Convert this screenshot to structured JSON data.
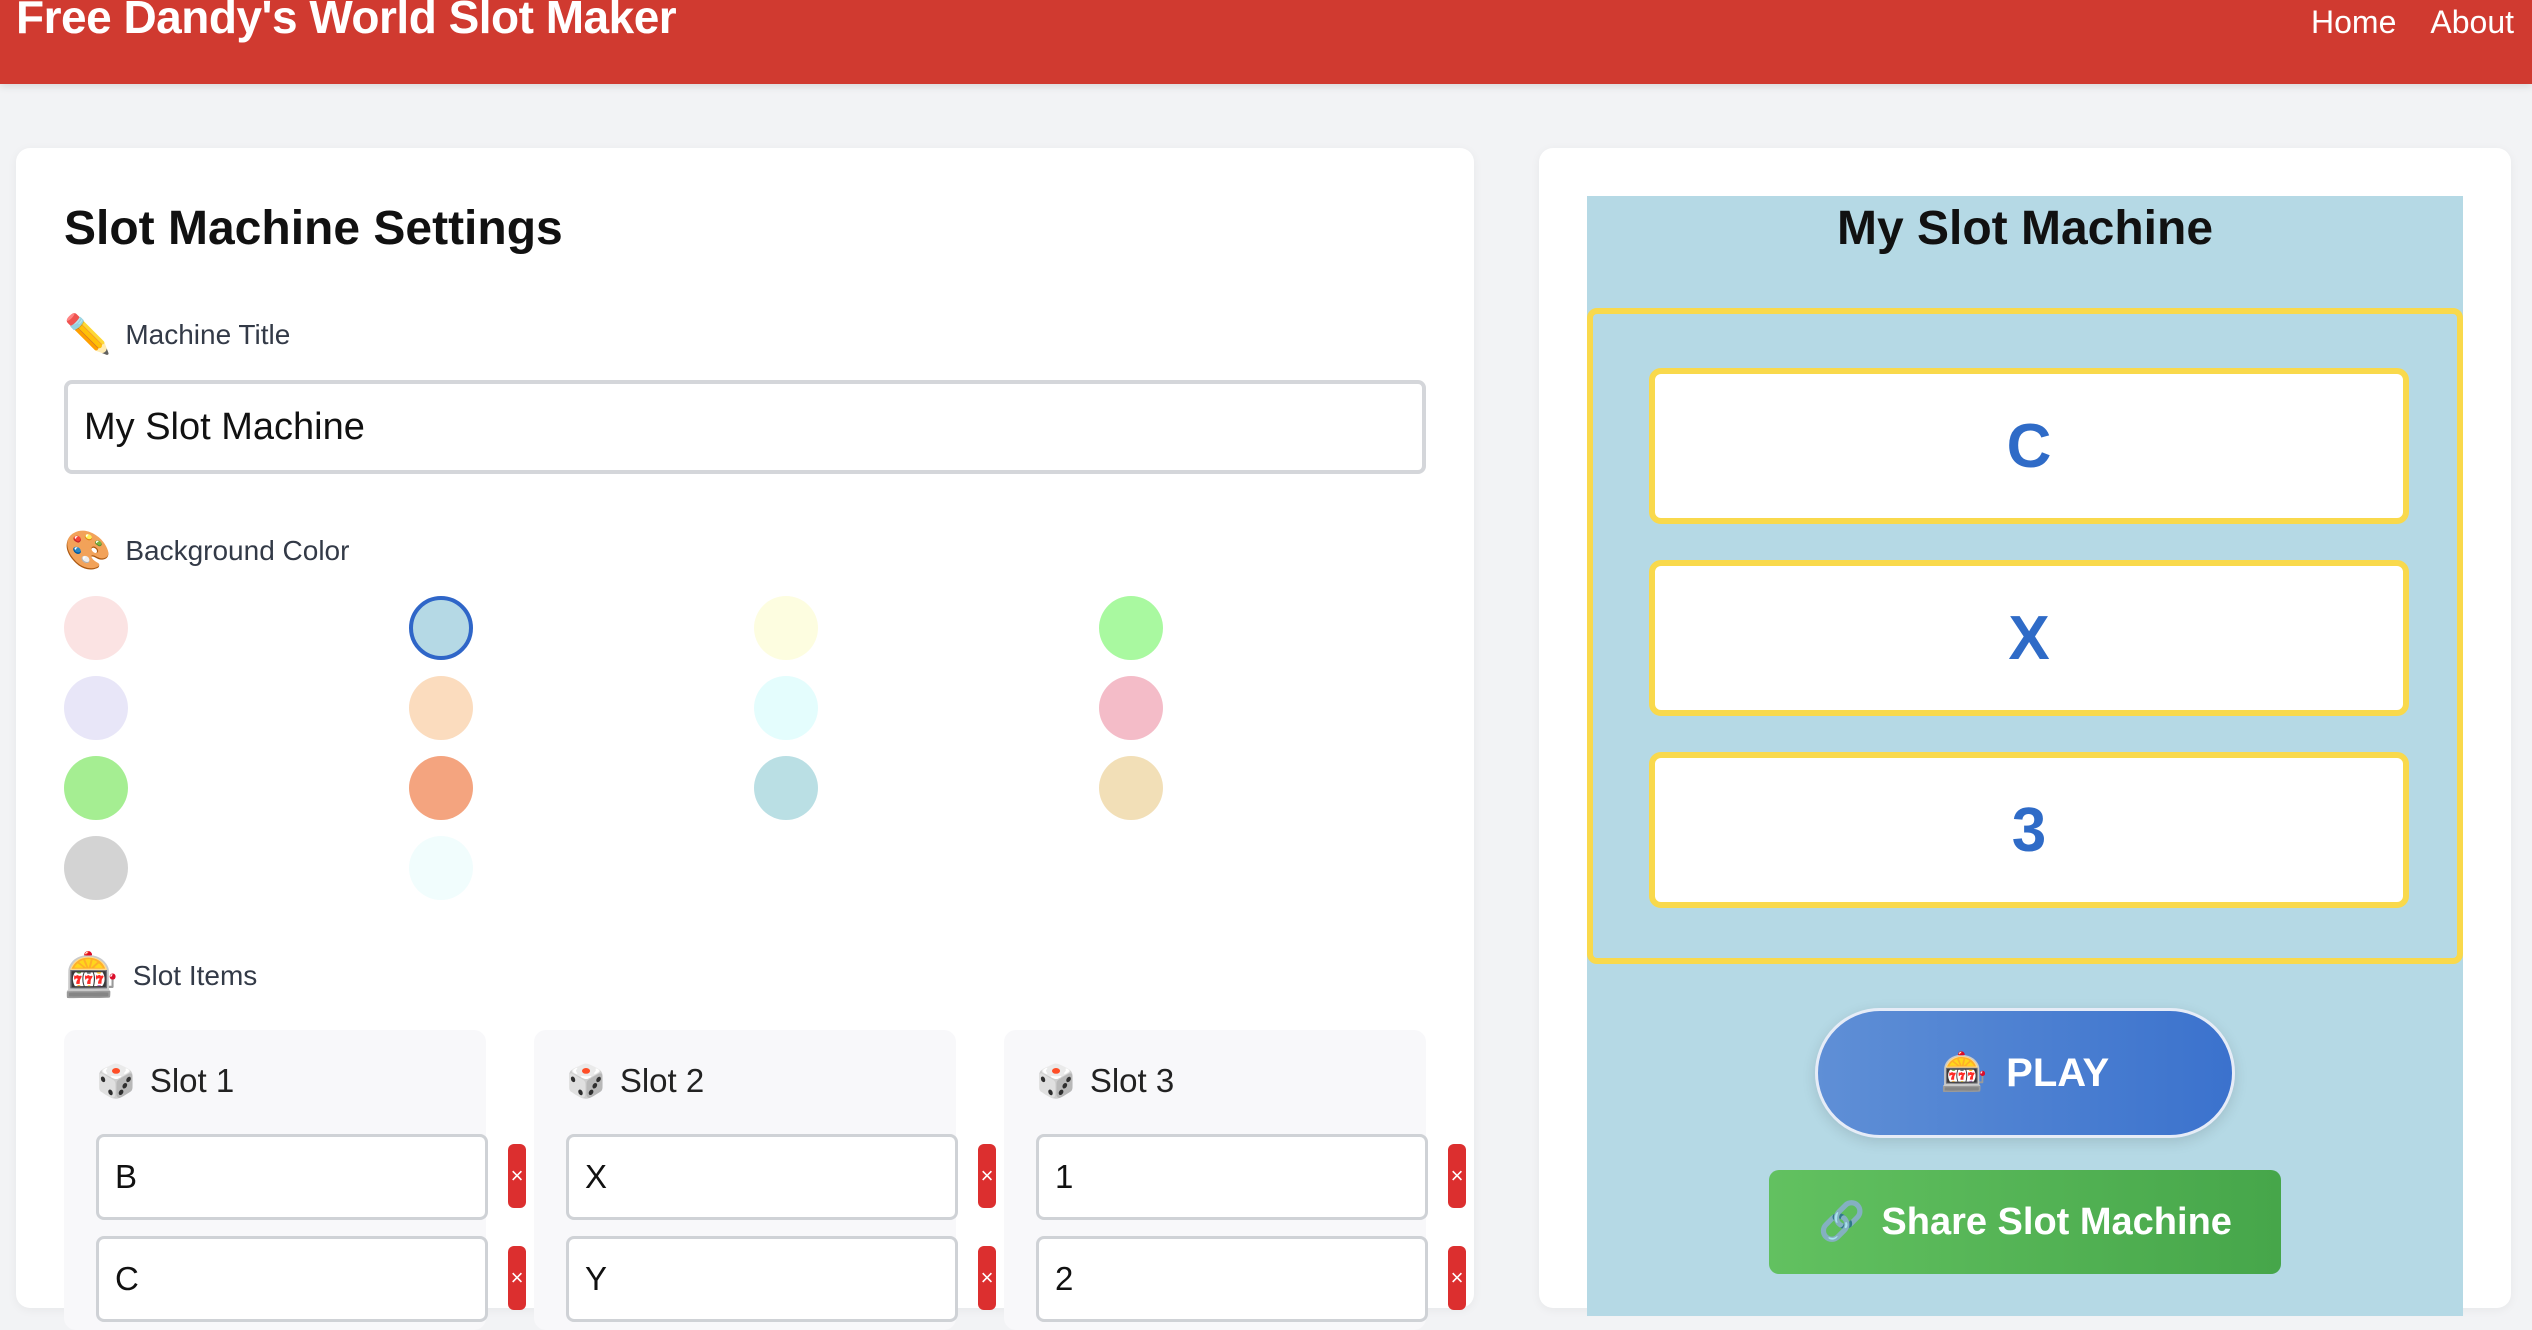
{
  "header": {
    "site_title": "Free Dandy's World Slot Maker",
    "nav": [
      "Home",
      "About"
    ]
  },
  "settings": {
    "title": "Slot Machine Settings",
    "machine_title_label": "Machine Title",
    "machine_title_icon": "pencil-icon",
    "machine_title_value": "My Slot Machine",
    "background_label": "Background Color",
    "background_icon": "palette-icon",
    "selected_color": "#b5d9e5",
    "colors": [
      "#fbe3e3",
      "#b5d9e5",
      "#fdfde0",
      "#a9f9a0",
      "#e8e6f8",
      "#fbdcbe",
      "#e4fdfd",
      "#f4bcc8",
      "#a5ee92",
      "#f4a47f",
      "#badfe4",
      "#f2dfb7",
      "#d3d3d3",
      "#f1fdfd"
    ],
    "slot_items_label": "Slot Items",
    "slot_items_icon": "slot-machine-icon",
    "slots": [
      {
        "name": "Slot 1",
        "icon": "dice-icon",
        "items": [
          "B",
          "C"
        ]
      },
      {
        "name": "Slot 2",
        "icon": "dice-icon",
        "items": [
          "X",
          "Y"
        ]
      },
      {
        "name": "Slot 3",
        "icon": "dice-icon",
        "items": [
          "1",
          "2"
        ]
      }
    ],
    "delete_glyph": "×"
  },
  "preview": {
    "title": "My Slot Machine",
    "reels": [
      "C",
      "X",
      "3"
    ],
    "play_label": "PLAY",
    "play_icon": "slot-machine-icon",
    "share_label": "Share Slot Machine",
    "share_icon": "link-icon",
    "bg_color": "#b5d9e5",
    "frame_color": "#f9d94c"
  }
}
